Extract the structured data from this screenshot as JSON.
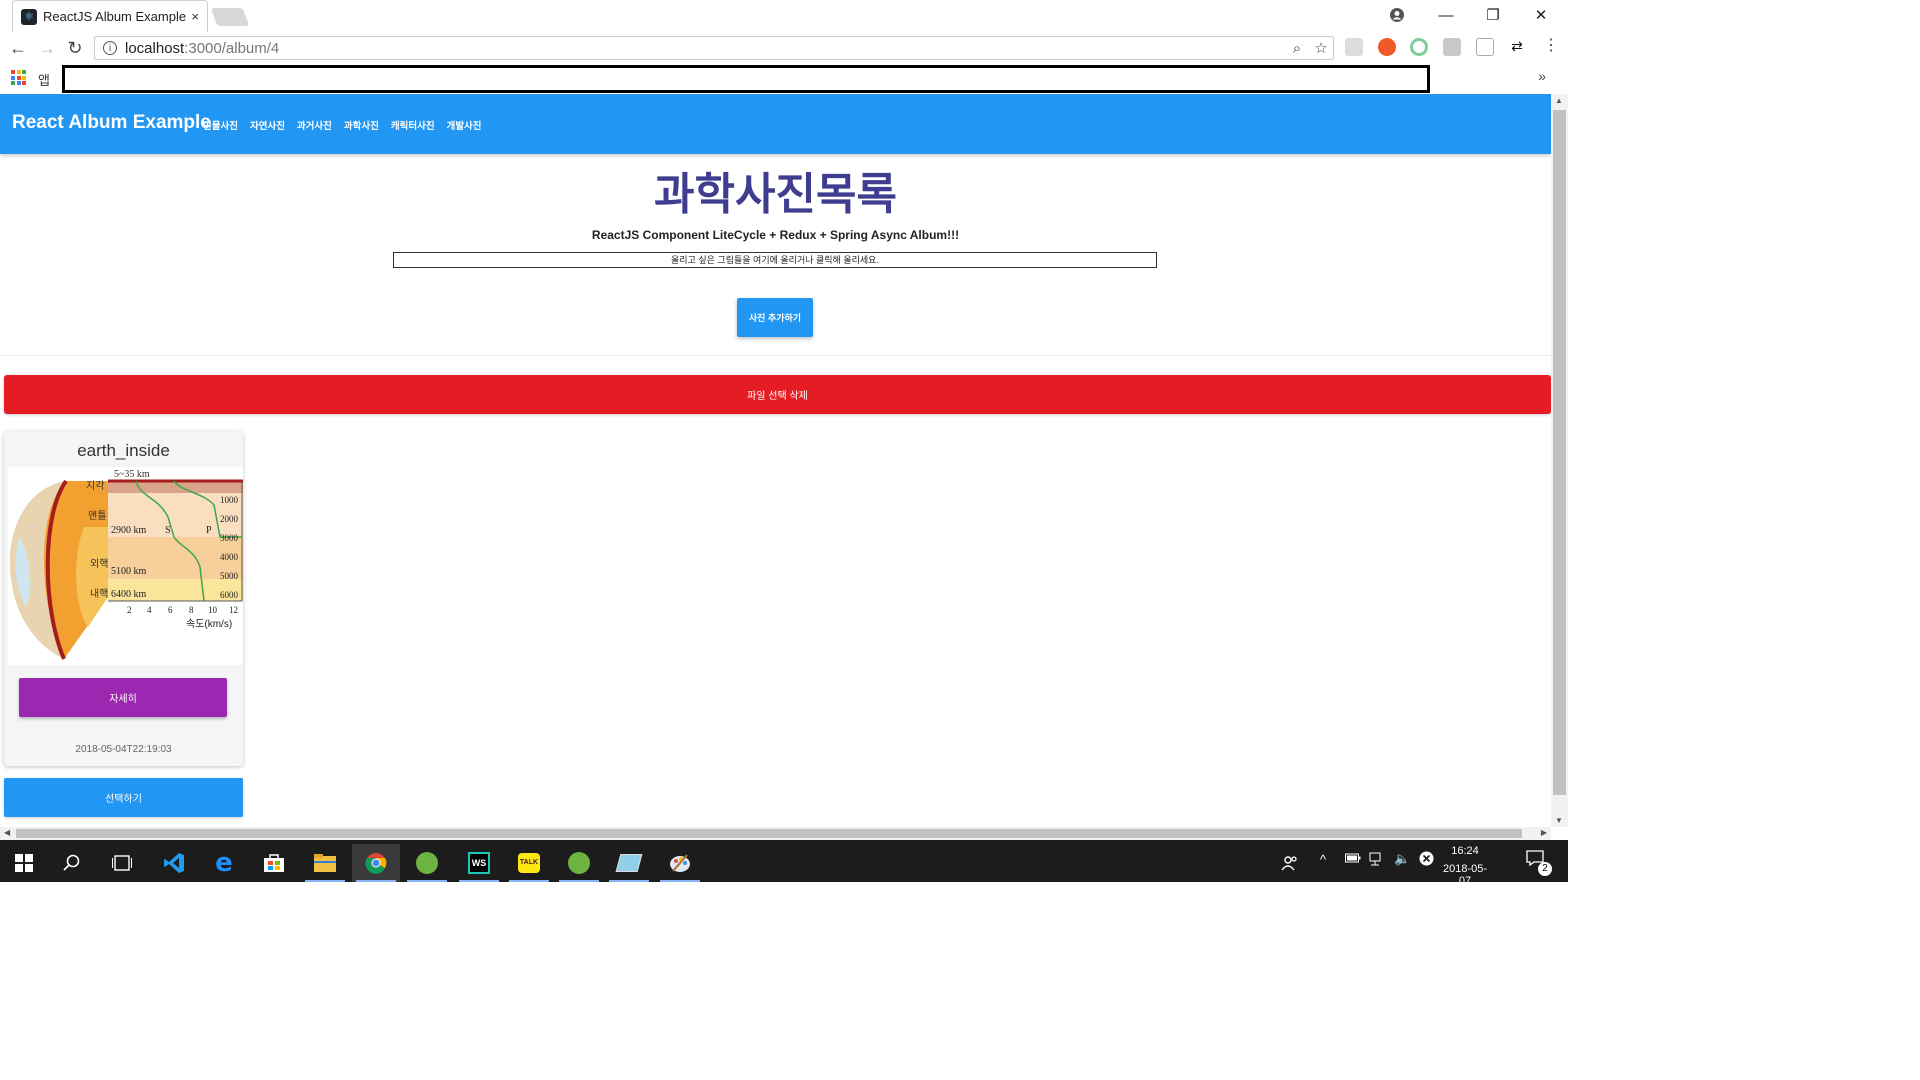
{
  "browser": {
    "tab_title": "ReactJS Album Example",
    "tab_close": "×",
    "url_host": "localhost",
    "url_path": ":3000/album/4",
    "bookmarks_apps_label": "앱",
    "bookmarks_more": "»",
    "window_controls": {
      "minimize": "—",
      "restore": "❐",
      "close": "✕"
    }
  },
  "app": {
    "brand": "React Album Example",
    "nav": [
      "인물사진",
      "자연사진",
      "과거사진",
      "과학사진",
      "캐릭터사진",
      "개발사진"
    ]
  },
  "main": {
    "title": "과학사진목록",
    "subtitle": "ReactJS Component LiteCycle + Redux + Spring Async Album!!!",
    "dropzone_text": "올리고 싶은 그림들을 여기에 올리거나 클릭해 올리세요.",
    "add_button": "사진 추가하기",
    "delete_button": "파일 선택 삭제",
    "select_button": "선택하기"
  },
  "card": {
    "title": "earth_inside",
    "detail_button": "자세히",
    "date": "2018-05-04T22:19:03",
    "diagram": {
      "top_label": "5~35 km",
      "layers": [
        "지각",
        "맨틀",
        "외핵",
        "내핵"
      ],
      "depth_labels": [
        "2900 km",
        "5100 km",
        "6400 km"
      ],
      "wave_labels": [
        "S",
        "P"
      ],
      "depth_ticks": [
        "1000",
        "2000",
        "3000",
        "4000",
        "5000",
        "6000"
      ],
      "speed_ticks": [
        "2",
        "4",
        "6",
        "8",
        "10",
        "12"
      ],
      "xlabel": "속도(km/s)"
    }
  },
  "taskbar": {
    "time": "16:24",
    "date": "2018-05-07",
    "notification_count": "2"
  }
}
